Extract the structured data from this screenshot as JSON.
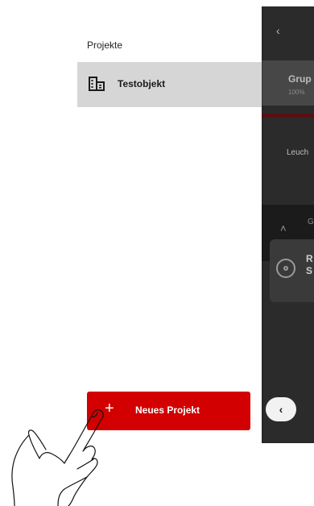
{
  "drawer": {
    "title": "Projekte",
    "items": [
      {
        "label": "Testobjekt",
        "icon": "building-icon"
      }
    ],
    "new_project_label": "Neues Projekt",
    "new_project_icon": "plus-icon"
  },
  "background_app": {
    "back_icon": "chevron-left-icon",
    "group_title": "Grup",
    "group_subtitle": "100%",
    "lights_label": "Leuch",
    "band_text": "G",
    "card_title_1": "R",
    "card_title_2": "S",
    "card_icon": "location-icon",
    "expand_icon": "chevron-up-icon",
    "collapse_icon": "chevron-left-icon"
  },
  "colors": {
    "accent": "#d20000",
    "selected_item_bg": "#d6d6d6",
    "overlay_dark": "#2b2b2b"
  }
}
